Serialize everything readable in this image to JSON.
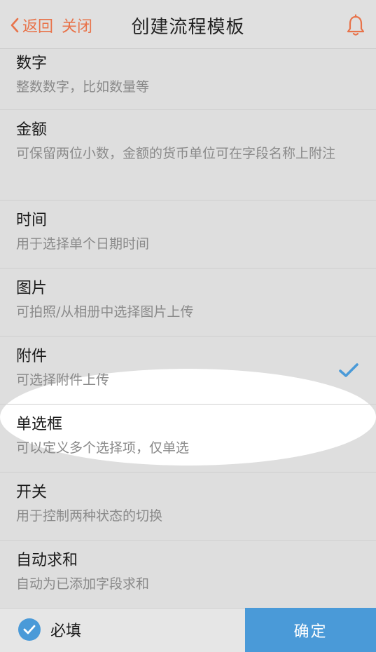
{
  "header": {
    "back_label": "返回",
    "close_label": "关闭",
    "title": "创建流程模板"
  },
  "items": [
    {
      "title": "数字",
      "desc": "整数数字，比如数量等"
    },
    {
      "title": "金额",
      "desc": "可保留两位小数，金额的货币单位可在字段名称上附注"
    },
    {
      "title": "时间",
      "desc": "用于选择单个日期时间"
    },
    {
      "title": "图片",
      "desc": "可拍照/从相册中选择图片上传"
    },
    {
      "title": "附件",
      "desc": "可选择附件上传",
      "selected": true
    },
    {
      "title": "单选框",
      "desc": "可以定义多个选择项，仅单选"
    },
    {
      "title": "开关",
      "desc": "用于控制两种状态的切换"
    },
    {
      "title": "自动求和",
      "desc": "自动为已添加字段求和"
    }
  ],
  "footer": {
    "required_label": "必填",
    "required_checked": true,
    "confirm_label": "确定"
  },
  "colors": {
    "accent_orange": "#e8734a",
    "accent_blue": "#4a9ad8",
    "background": "#dedede"
  },
  "icons": {
    "back": "chevron-left-icon",
    "bell": "bell-icon",
    "check": "checkmark-icon",
    "required": "check-circle-icon"
  }
}
